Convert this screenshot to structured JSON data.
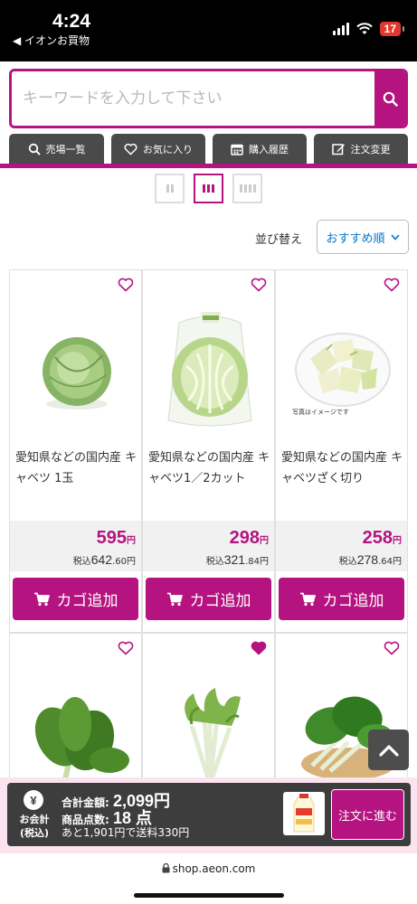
{
  "status_bar": {
    "time": "4:24",
    "back_app": "◀ イオンお買物",
    "battery": "17"
  },
  "search": {
    "placeholder": "キーワードを入力して下さい"
  },
  "tabs": [
    {
      "label": "売場一覧",
      "icon": "search-icon"
    },
    {
      "label": "お気に入り",
      "icon": "heart-icon"
    },
    {
      "label": "購入履歴",
      "icon": "calendar-icon"
    },
    {
      "label": "注文変更",
      "icon": "edit-icon"
    }
  ],
  "sort": {
    "label": "並び替え",
    "selected": "おすすめ順"
  },
  "products": [
    {
      "name": "愛知県などの国内産 キャベツ 1玉",
      "price": "595",
      "yen": "円",
      "tax_prefix": "税込",
      "tax_int": "642",
      "tax_dec": ".60",
      "favorite": false,
      "cart_label": "カゴ追加"
    },
    {
      "name": "愛知県などの国内産 キャベツ1／2カット",
      "price": "298",
      "yen": "円",
      "tax_prefix": "税込",
      "tax_int": "321",
      "tax_dec": ".84",
      "favorite": false,
      "cart_label": "カゴ追加"
    },
    {
      "name": "愛知県などの国内産 キャベツざく切り",
      "price": "258",
      "yen": "円",
      "tax_prefix": "税込",
      "tax_int": "278",
      "tax_dec": ".64",
      "favorite": false,
      "cart_label": "カゴ追加",
      "image_note": "写真はイメージです"
    },
    {
      "favorite": false
    },
    {
      "favorite": true
    },
    {
      "favorite": false
    }
  ],
  "checkout": {
    "yen_symbol": "¥",
    "label": "お会計\n(税込)",
    "total_label": "合計金額:",
    "total_value": "2,099円",
    "count_label": "商品点数:",
    "count_value": "18 点",
    "shipping_note": "あと1,901円で送料330円",
    "order_button": "注文に進む"
  },
  "browser": {
    "url": "shop.aeon.com"
  },
  "colors": {
    "accent": "#b5137f",
    "dark": "#3d3d3d",
    "link": "#0077c8"
  }
}
